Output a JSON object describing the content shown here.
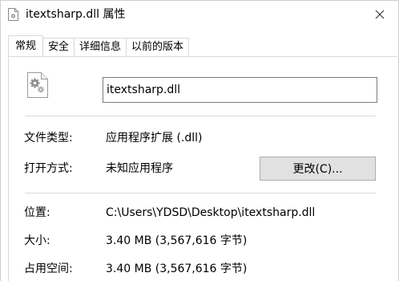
{
  "window": {
    "title": "itextsharp.dll 属性"
  },
  "tabs": [
    {
      "label": "常规",
      "active": true
    },
    {
      "label": "安全",
      "active": false
    },
    {
      "label": "详细信息",
      "active": false
    },
    {
      "label": "以前的版本",
      "active": false
    }
  ],
  "general": {
    "file_name": "itextsharp.dll",
    "file_type_label": "文件类型:",
    "file_type_value": "应用程序扩展 (.dll)",
    "open_with_label": "打开方式:",
    "open_with_value": "未知应用程序",
    "change_button": "更改(C)...",
    "location_label": "位置:",
    "location_value": "C:\\Users\\YDSD\\Desktop\\itextsharp.dll",
    "size_label": "大小:",
    "size_value": "3.40 MB (3,567,616 字节)",
    "size_on_disk_label": "占用空间:",
    "size_on_disk_value": "3.40 MB (3,567,616 字节)"
  },
  "icons": {
    "title": "dll-file-icon",
    "close": "close-icon",
    "file": "dll-gear-file-icon"
  },
  "colors": {
    "tab_border": "#d9d9d9",
    "button_bg": "#e1e1e1",
    "button_border": "#adadad",
    "divider": "#dadada"
  }
}
